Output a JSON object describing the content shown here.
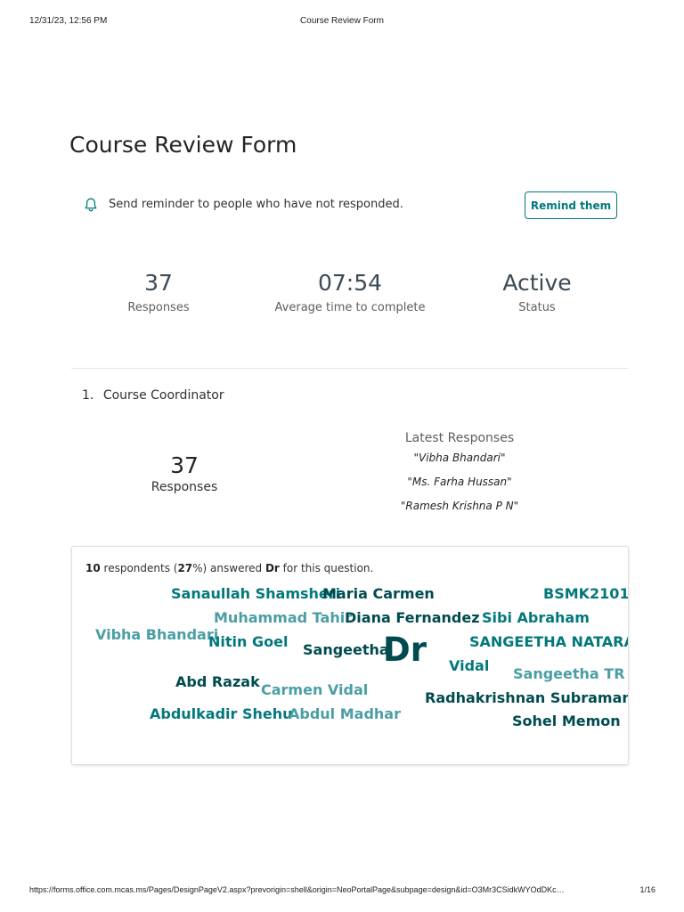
{
  "print": {
    "datetime": "12/31/23, 12:56 PM",
    "doc_title": "Course Review Form",
    "url": "https://forms.office.com.mcas.ms/Pages/DesignPageV2.aspx?prevorigin=shell&origin=NeoPortalPage&subpage=design&id=O3Mr3CSidkWYOdDKc…",
    "page": "1/16"
  },
  "form": {
    "title": "Course Review Form"
  },
  "reminder": {
    "icon": "bell-icon",
    "text": "Send reminder to people who have not responded.",
    "button_label": "Remind them"
  },
  "stats": {
    "responses": {
      "value": "37",
      "label": "Responses"
    },
    "avg_time": {
      "value": "07:54",
      "label": "Average time to complete"
    },
    "status": {
      "value": "Active",
      "label": "Status"
    }
  },
  "question": {
    "number": "1.",
    "title": "Course Coordinator",
    "responses": {
      "value": "37",
      "label": "Responses"
    },
    "latest_heading": "Latest Responses",
    "latest": [
      "\"Vibha Bhandari\"",
      "\"Ms. Farha Hussan\"",
      "\"Ramesh Krishna P N\""
    ]
  },
  "word_cloud": {
    "summary": {
      "count": "10",
      "pre": " respondents (",
      "percent": "27",
      "mid": "%) answered ",
      "term": "Dr",
      "post": " for this question."
    },
    "words": [
      "Sanaullah Shamsheri",
      "Maria Carmen",
      "BSMK2101",
      "Muhammad Tahir",
      "Diana Fernandez",
      "Sibi Abraham",
      "Vibha Bhandari",
      "Nitin Goel",
      "Sangeetha",
      "Dr",
      "SANGEETHA NATARAJAN",
      "Vidal",
      "Sangeetha TR",
      "Abd Razak",
      "Carmen Vidal",
      "Radhakrishnan Subramani",
      "Abdulkadir Shehu",
      "Abdul Madhar",
      "Sohel Memon"
    ]
  },
  "colors": {
    "accent": "#03787c",
    "dark_teal": "#004b50",
    "light_teal": "#4a9ea4"
  }
}
